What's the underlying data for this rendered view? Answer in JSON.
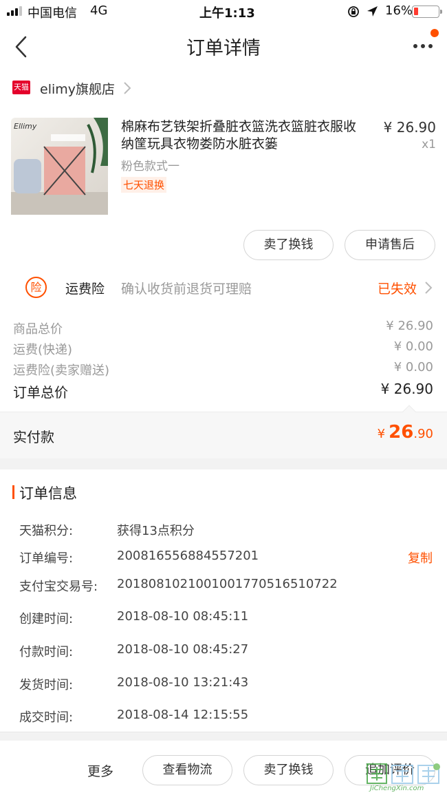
{
  "status_bar": {
    "carrier": "中国电信",
    "network": "4G",
    "time": "上午1:13",
    "battery": "16%"
  },
  "nav": {
    "title": "订单详情"
  },
  "shop": {
    "badge": "天猫",
    "name": "elimy旗舰店"
  },
  "product": {
    "image_brand": "Ellimy",
    "title": "棉麻布艺铁架折叠脏衣篮洗衣篮脏衣服收纳筐玩具衣物娄防水脏衣篓",
    "variant": "粉色款式一",
    "return_tag": "七天退换",
    "price": "¥ 26.90",
    "quantity": "x1"
  },
  "item_actions": {
    "sell_label": "卖了换钱",
    "after_sale_label": "申请售后"
  },
  "insurance": {
    "icon_char": "险",
    "title": "运费险",
    "desc": "确认收货前退货可理赔",
    "status": "已失效"
  },
  "summary": {
    "rows": [
      {
        "label": "商品总价",
        "value": "¥ 26.90"
      },
      {
        "label": "运费(快递)",
        "value": "¥ 0.00"
      },
      {
        "label": "运费险(卖家赠送)",
        "value": "¥ 0.00"
      }
    ],
    "total_label": "订单总价",
    "total_value": "¥ 26.90",
    "paid_label": "实付款",
    "paid_currency": "¥",
    "paid_integer": "26",
    "paid_decimal": ".90"
  },
  "order_info": {
    "heading": "订单信息",
    "copy_label": "复制",
    "rows": [
      {
        "label": "天猫积分:",
        "value": "获得13点积分"
      },
      {
        "label": "订单编号:",
        "value": "200816556884557201"
      },
      {
        "label": "支付宝交易号:",
        "value": "2018081021001001770516510722"
      },
      {
        "label": "创建时间:",
        "value": "2018-08-10 08:45:11"
      },
      {
        "label": "付款时间:",
        "value": "2018-08-10 08:45:27"
      },
      {
        "label": "发货时间:",
        "value": "2018-08-10 13:21:43"
      },
      {
        "label": "成交时间:",
        "value": "2018-08-14 12:15:55"
      }
    ]
  },
  "bottom_bar": {
    "more_label": "更多",
    "logistics_label": "查看物流",
    "sell_label": "卖了换钱",
    "review_label": "追加评价"
  },
  "watermark": {
    "text": "JiChengXin.com"
  },
  "colors": {
    "accent": "#ff5000",
    "tmall_red": "#e4002b"
  }
}
